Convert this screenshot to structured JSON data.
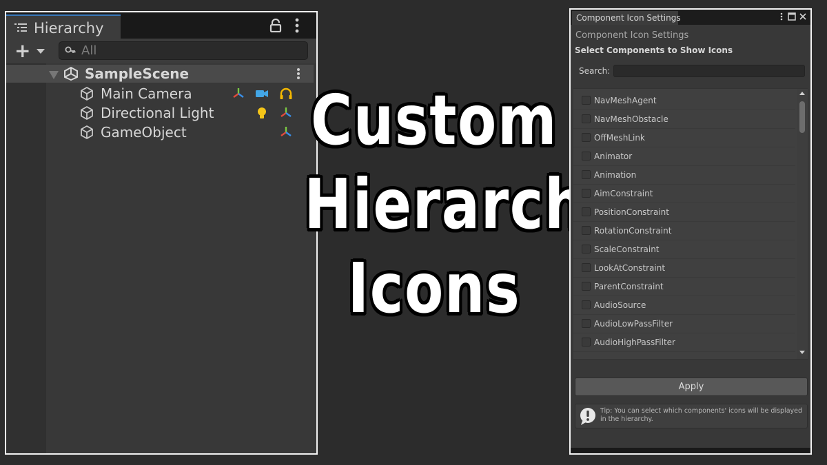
{
  "hierarchy": {
    "tab_title": "Hierarchy",
    "search_placeholder": "All",
    "scene_name": "SampleScene",
    "objects": [
      {
        "name": "Main Camera",
        "icons": [
          "transform-icon",
          "camera-icon",
          "audio-listener-icon"
        ]
      },
      {
        "name": "Directional Light",
        "icons": [
          "light-icon",
          "transform-icon"
        ]
      },
      {
        "name": "GameObject",
        "icons": [
          "transform-icon"
        ]
      }
    ]
  },
  "headline": {
    "line1": "Custom",
    "line2": "Hierarchy",
    "line3": "Icons"
  },
  "settings": {
    "tab_title": "Component Icon Settings",
    "header": "Component Icon Settings",
    "subtitle": "Select Components to Show Icons",
    "search_label": "Search:",
    "search_value": "",
    "components": [
      "NavMeshAgent",
      "NavMeshObstacle",
      "OffMeshLink",
      "Animator",
      "Animation",
      "AimConstraint",
      "PositionConstraint",
      "RotationConstraint",
      "ScaleConstraint",
      "LookAtConstraint",
      "ParentConstraint",
      "AudioSource",
      "AudioLowPassFilter",
      "AudioHighPassFilter"
    ],
    "checked": [
      false,
      false,
      false,
      false,
      false,
      false,
      false,
      false,
      false,
      false,
      false,
      false,
      false,
      false
    ],
    "apply_label": "Apply",
    "tip": "Tip: You can select which components' icons will be displayed in the hierarchy."
  },
  "colors": {
    "accent_tab": "#3a79bb",
    "camera_icon": "#43a6e6",
    "audio_icon": "#f5b800",
    "light_icon": "#f5c518",
    "axis_red": "#e04a3a",
    "axis_green": "#7ac943",
    "axis_blue": "#3a8ee6"
  }
}
